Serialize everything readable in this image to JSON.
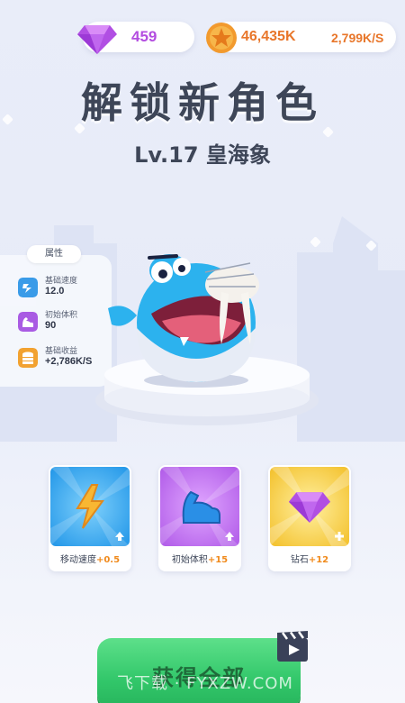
{
  "currency": {
    "gems": "459",
    "coins": "46,435K",
    "coin_rate": "2,799K/S"
  },
  "title": "解锁新角色",
  "subtitle": "Lv.17 皇海象",
  "attributes": {
    "header": "属性",
    "items": [
      {
        "label": "基础速度",
        "value": "12.0",
        "icon": "speed-icon"
      },
      {
        "label": "初始体积",
        "value": "90",
        "icon": "muscle-icon"
      },
      {
        "label": "基础收益",
        "value": "+2,786K/S",
        "icon": "coins-icon"
      }
    ]
  },
  "character": {
    "icon": "walrus-character"
  },
  "upgrades": [
    {
      "label": "移动速度",
      "bonus": "+0.5",
      "icon": "lightning-icon",
      "badge": "arrow-up-icon",
      "color": "#3aa9ef"
    },
    {
      "label": "初始体积",
      "bonus": "+15",
      "icon": "muscle-icon",
      "badge": "arrow-up-icon",
      "color": "#b866e8"
    },
    {
      "label": "钻石",
      "bonus": "+12",
      "icon": "gem-icon",
      "badge": "plus-icon",
      "color": "#f4c62a"
    }
  ],
  "get_all": {
    "label": "获得全部",
    "icon": "video-ad-icon"
  },
  "watermark": "飞下载 · FYXZW.COM"
}
